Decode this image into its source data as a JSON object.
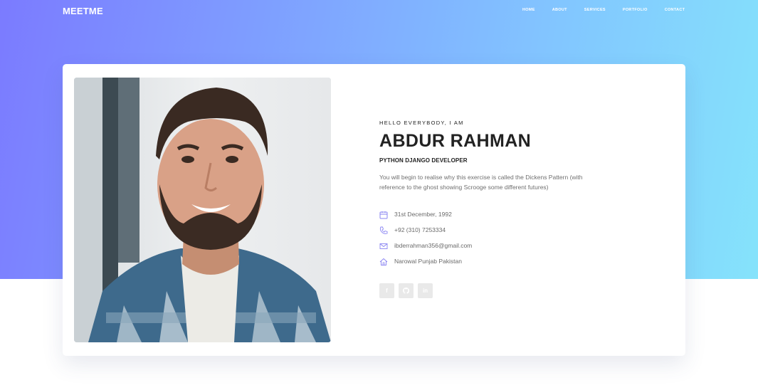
{
  "brand": {
    "logo": "MEETME"
  },
  "nav": {
    "items": [
      "HOME",
      "ABOUT",
      "SERVICES",
      "PORTFOLIO",
      "CONTACT"
    ]
  },
  "profile": {
    "greeting": "HELLO EVERYBODY, I AM",
    "name": "ABDUR RAHMAN",
    "role": "PYTHON DJANGO DEVELOPER",
    "bio": "You will begin to realise why this exercise is called the Dickens Pattern (with reference to the ghost showing Scrooge some different futures)"
  },
  "contacts": [
    {
      "icon": "calendar-icon",
      "text": "31st December, 1992"
    },
    {
      "icon": "phone-icon",
      "text": "+92 (310) 7253334"
    },
    {
      "icon": "mail-icon",
      "text": "ibderrahman356@gmail.com"
    },
    {
      "icon": "home-icon",
      "text": "Narowal Punjab Pakistan"
    }
  ],
  "socials": [
    {
      "icon": "facebook-icon",
      "glyph": "f"
    },
    {
      "icon": "github-icon",
      "glyph": ""
    },
    {
      "icon": "linkedin-icon",
      "glyph": "in"
    }
  ],
  "colors": {
    "gradient_start": "#7b7bff",
    "gradient_end": "#85e3fb",
    "icon_accent": "#8a84f2",
    "text_dark": "#222222",
    "text_muted": "#6f6f6f"
  }
}
